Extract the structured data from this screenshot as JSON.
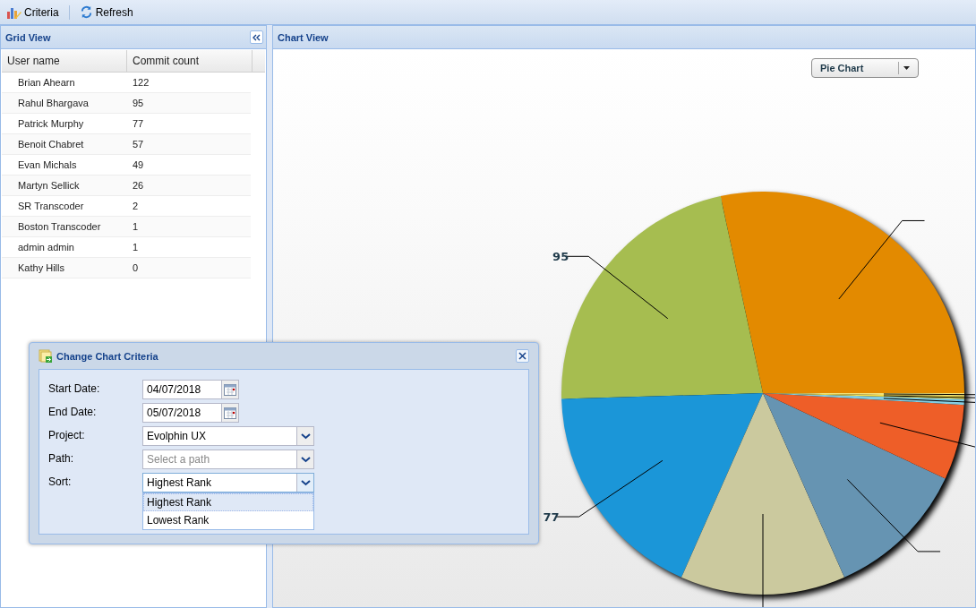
{
  "toolbar": {
    "buttons": [
      {
        "label": "Criteria",
        "kind": "criteria"
      },
      {
        "label": "Refresh",
        "kind": "refresh"
      }
    ]
  },
  "grid_panel": {
    "title": "Grid View",
    "columns": [
      "User name",
      "Commit count"
    ],
    "rows": [
      [
        "Brian Ahearn",
        "122"
      ],
      [
        "Rahul Bhargava",
        "95"
      ],
      [
        "Patrick Murphy",
        "77"
      ],
      [
        "Benoit Chabret",
        "57"
      ],
      [
        "Evan Michals",
        "49"
      ],
      [
        "Martyn Sellick",
        "26"
      ],
      [
        "SR Transcoder",
        "2"
      ],
      [
        "Boston Transcoder",
        "1"
      ],
      [
        "admin admin",
        "1"
      ],
      [
        "Kathy Hills",
        "0"
      ]
    ]
  },
  "chart_panel": {
    "title": "Chart View",
    "chart_type": {
      "value": "Pie Chart"
    },
    "chart_data": {
      "type": "pie",
      "values": [
        122,
        95,
        77,
        57,
        49,
        26,
        2,
        1,
        1
      ],
      "colors": [
        "#e38a00",
        "#a6bd50",
        "#1b96d8",
        "#cbc99e",
        "#6694b2",
        "#ee5e28",
        "#83cde2",
        "#f7e14a",
        "#f2e27a"
      ],
      "value_labels": [
        null,
        "95",
        "77",
        null,
        null,
        null,
        null,
        null,
        null
      ]
    }
  },
  "dialog": {
    "title": "Change Chart Criteria",
    "fields": [
      {
        "label": "Start Date:",
        "kind": "date",
        "value": "04/07/2018"
      },
      {
        "label": "End Date:",
        "kind": "date",
        "value": "05/07/2018"
      },
      {
        "label": "Project:",
        "kind": "combo",
        "value": "Evolphin UX",
        "expanded": false
      },
      {
        "label": "Path:",
        "kind": "combo",
        "placeholder": "Select a path",
        "expanded": false
      },
      {
        "label": "Sort:",
        "kind": "combo",
        "value": "Highest Rank",
        "expanded": true,
        "options": [
          {
            "label": "Highest Rank",
            "selected": true
          },
          {
            "label": "Lowest Rank",
            "selected": false
          }
        ]
      }
    ]
  }
}
